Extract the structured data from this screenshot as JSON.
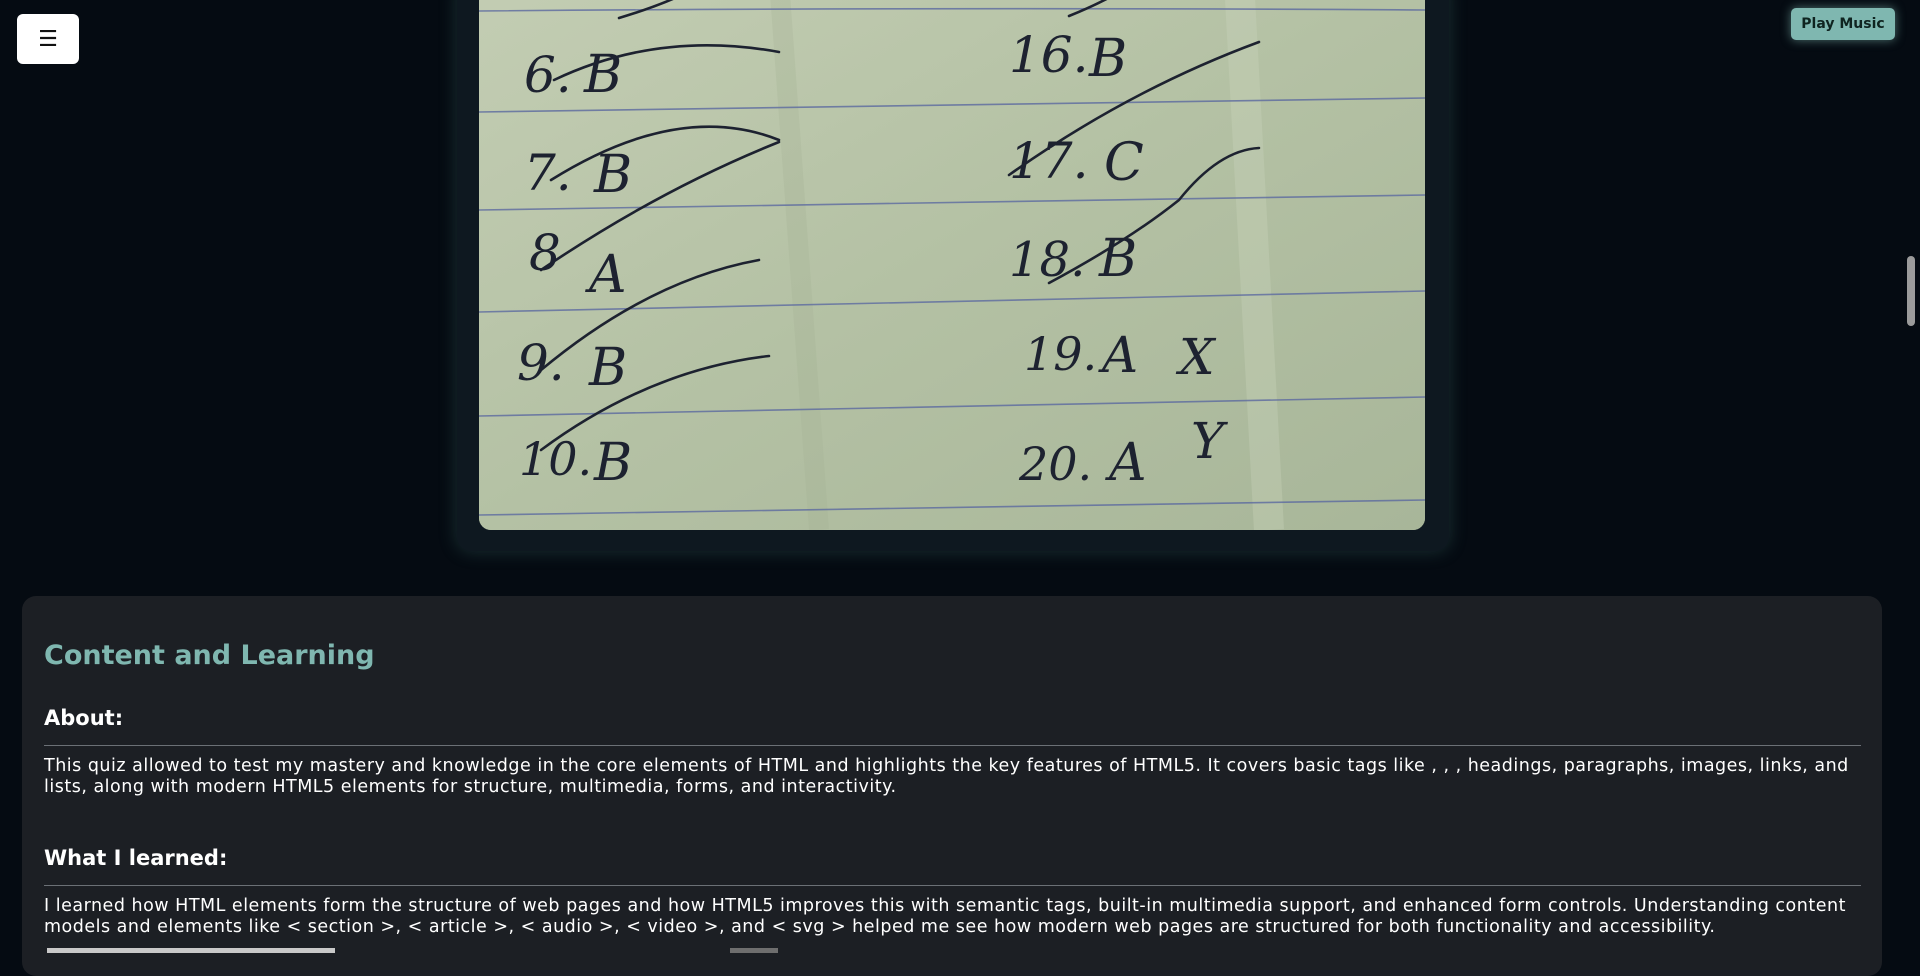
{
  "menu": {
    "icon": "hamburger-menu-icon",
    "glyph": "☰"
  },
  "play_music": {
    "label": "Play Music",
    "color": "#7fb7b0"
  },
  "photo": {
    "description_lines": [
      {
        "left": "6.",
        "left_answer": "B",
        "right": "16.",
        "right_answer": "B"
      },
      {
        "left": "7.",
        "left_answer": "B",
        "right": "17.",
        "right_answer": "C"
      },
      {
        "left": "8.",
        "left_answer": "A",
        "right": "18.",
        "right_answer": "B"
      },
      {
        "left": "9.",
        "left_answer": "B",
        "right": "19.",
        "right_answer": "A",
        "right_mark": "X"
      },
      {
        "left": "10.",
        "left_answer": "B",
        "right": "20.",
        "right_answer": "A",
        "right_mark": "Y"
      }
    ]
  },
  "content": {
    "title": "Content and Learning",
    "about_heading": "About:",
    "about_text": "This quiz allowed to test my mastery and knowledge in the core elements of HTML and highlights the key features of HTML5. It covers basic tags like , , , headings, paragraphs, images, links, and lists, along with modern HTML5 elements for structure, multimedia, forms, and interactivity.",
    "learned_heading": "What I learned:",
    "learned_text": "I learned how HTML elements form the structure of web pages and how HTML5 improves this with semantic tags, built-in multimedia support, and enhanced form controls. Understanding content models and elements like < section >, < article >, < audio >, < video >, and < svg > helped me see how modern web pages are structured for both functionality and accessibility."
  },
  "colors": {
    "background": "#050b12",
    "card": "#1c1f24",
    "accent": "#7fb7b0"
  }
}
